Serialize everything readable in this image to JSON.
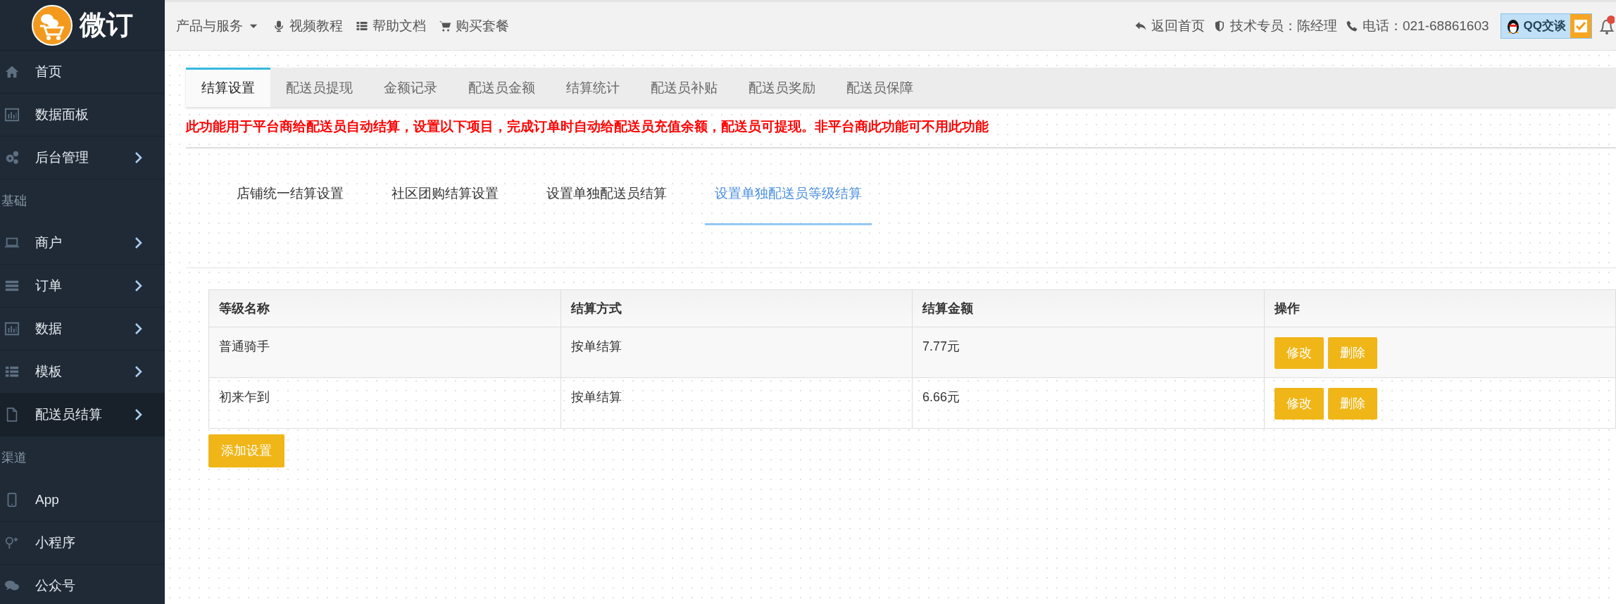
{
  "sidebar": {
    "logo_text": "微订",
    "items": [
      {
        "kind": "item",
        "label": "首页",
        "expandable": false,
        "selected": false
      },
      {
        "kind": "item",
        "label": "数据面板",
        "expandable": false,
        "selected": false
      },
      {
        "kind": "item",
        "label": "后台管理",
        "expandable": true,
        "selected": false
      },
      {
        "kind": "header",
        "label": "基础"
      },
      {
        "kind": "item",
        "label": "商户",
        "expandable": true,
        "selected": false
      },
      {
        "kind": "item",
        "label": "订单",
        "expandable": true,
        "selected": false
      },
      {
        "kind": "item",
        "label": "数据",
        "expandable": true,
        "selected": false
      },
      {
        "kind": "item",
        "label": "模板",
        "expandable": true,
        "selected": false
      },
      {
        "kind": "item",
        "label": "配送员结算",
        "expandable": true,
        "selected": true
      },
      {
        "kind": "header",
        "label": "渠道"
      },
      {
        "kind": "item",
        "label": "App",
        "expandable": false,
        "selected": false
      },
      {
        "kind": "item",
        "label": "小程序",
        "expandable": false,
        "selected": false
      },
      {
        "kind": "item",
        "label": "公众号",
        "expandable": false,
        "selected": false
      }
    ]
  },
  "top_bar": {
    "left": [
      "产品与服务",
      "视频教程",
      "帮助文档",
      "购买套餐"
    ],
    "right": [
      "返回首页",
      "技术专员：陈经理",
      "电话：021-68861603"
    ],
    "qq_button": "QQ交谈"
  },
  "tabs": [
    {
      "label": "结算设置",
      "selected": true
    },
    {
      "label": "配送员提现",
      "selected": false
    },
    {
      "label": "金额记录",
      "selected": false
    },
    {
      "label": "配送员金额",
      "selected": false
    },
    {
      "label": "结算统计",
      "selected": false
    },
    {
      "label": "配送员补贴",
      "selected": false
    },
    {
      "label": "配送员奖励",
      "selected": false
    },
    {
      "label": "配送员保障",
      "selected": false
    }
  ],
  "notice": "此功能用于平台商给配送员自动结算，设置以下项目，完成订单时自动给配送员充值余额，配送员可提现。非平台商此功能可不用此功能",
  "sub_tabs": [
    {
      "label": "店铺统一结算设置",
      "selected": false
    },
    {
      "label": "社区团购结算设置",
      "selected": false
    },
    {
      "label": "设置单独配送员结算",
      "selected": false
    },
    {
      "label": "设置单独配送员等级结算",
      "selected": true
    }
  ],
  "table": {
    "columns": [
      "等级名称",
      "结算方式",
      "结算金额",
      "操作"
    ],
    "rows": [
      {
        "cells": [
          "普通骑手",
          "按单结算",
          "7.77元"
        ],
        "actions": [
          "修改",
          "删除"
        ]
      },
      {
        "cells": [
          "初来乍到",
          "按单结算",
          "6.66元"
        ],
        "actions": [
          "修改",
          "删除"
        ]
      }
    ]
  },
  "add_button": "添加设置"
}
